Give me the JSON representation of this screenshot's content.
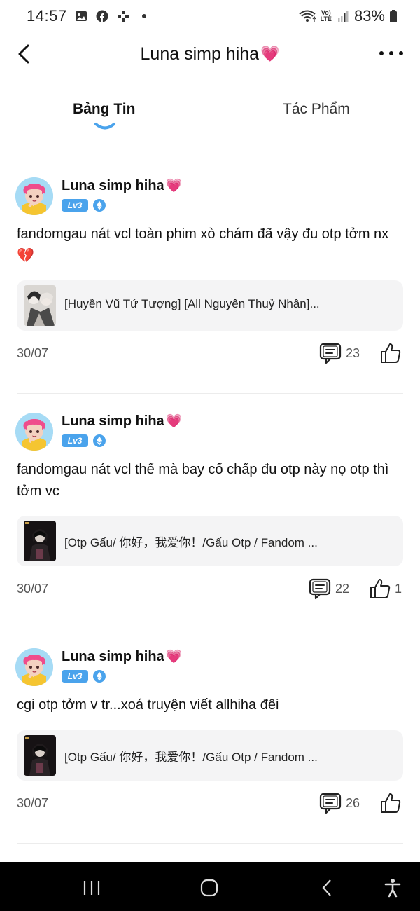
{
  "status_bar": {
    "time": "14:57",
    "icons_left": [
      "gallery-icon",
      "facebook-icon",
      "game-controller-icon",
      "notification-dot"
    ],
    "icons_right": [
      "wifi-icon",
      "volte-lte-icon",
      "signal-icon",
      "battery-icon"
    ],
    "volte_label": "Vo)",
    "lte_label": "LTE",
    "battery": "83%"
  },
  "header": {
    "title": "Luna simp hiha",
    "title_emoji": "💗"
  },
  "tabs": [
    {
      "label": "Bảng Tin",
      "active": true
    },
    {
      "label": "Tác Phẩm",
      "active": false
    }
  ],
  "posts": [
    {
      "author": "Luna simp hiha",
      "author_emoji": "💗",
      "level": "Lv3",
      "text": "fandomgau nát vcl toàn phim xò chám đã vậy đu otp tởm nx 💔",
      "work_title": "[Huyền Vũ Tứ Tượng] [All Nguyên Thuỷ Nhân]...",
      "date": "30/07",
      "comments": "23",
      "likes": ""
    },
    {
      "author": "Luna simp hiha",
      "author_emoji": "💗",
      "level": "Lv3",
      "text": "fandomgau nát vcl thế mà bay cố chấp đu otp này nọ otp thì tởm vc",
      "work_title": "[Otp Gấu/ 你好，我爱你！/Gấu Otp / Fandom ...",
      "date": "30/07",
      "comments": "22",
      "likes": "1"
    },
    {
      "author": "Luna simp hiha",
      "author_emoji": "💗",
      "level": "Lv3",
      "text": "cgi otp tởm v tr...xoá truyện viết allhiha đêi",
      "work_title": "[Otp Gấu/ 你好，我爱你！/Gấu Otp / Fandom ...",
      "date": "30/07",
      "comments": "26",
      "likes": ""
    }
  ],
  "colors": {
    "accent": "#4aa3ec",
    "card_bg": "#f4f4f5",
    "nav_bg": "#000000"
  }
}
